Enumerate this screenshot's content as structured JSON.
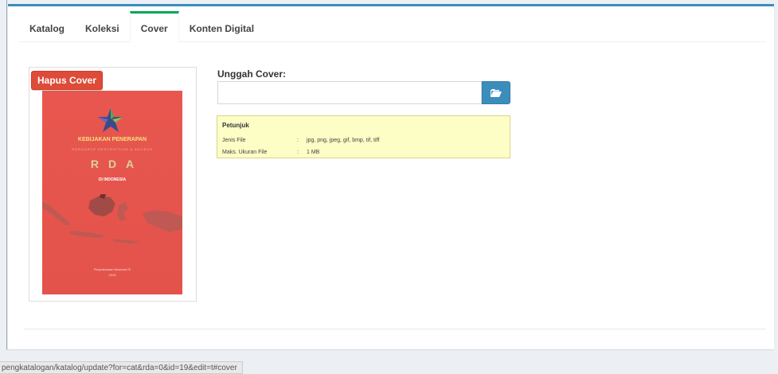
{
  "tabs": [
    {
      "label": "Katalog",
      "active": false
    },
    {
      "label": "Koleksi",
      "active": false
    },
    {
      "label": "Cover",
      "active": true
    },
    {
      "label": "Konten Digital",
      "active": false
    }
  ],
  "cover": {
    "delete_button": "Hapus Cover",
    "book": {
      "title": "KEBIJAKAN PENERAPAN",
      "subtitle": "RESOURCE DESCRIPTION & ACCESS",
      "rda": "RDA",
      "country": "DI INDONESIA",
      "publisher": "Perpustakaan Nasional RI",
      "year": "2015"
    }
  },
  "upload": {
    "label": "Unggah Cover:",
    "value": "",
    "browse_icon": "folder-open-icon"
  },
  "petunjuk": {
    "title": "Petunjuk",
    "rows": [
      {
        "key": "Jenis File",
        "sep": ":",
        "value": "jpg, png, jpeg, gif, bmp, tif, tiff"
      },
      {
        "key": "Maks. Ukuran File",
        "sep": ":",
        "value": "1 MB"
      }
    ]
  },
  "status_bar": {
    "url": "pengkatalogan/katalog/update?for=cat&rda=0&id=19&edit=t#cover"
  },
  "colors": {
    "accent": "#3c8dbc",
    "active_tab": "#00a65a",
    "danger": "#dd4b39",
    "hint_bg": "#fdfdc6"
  }
}
